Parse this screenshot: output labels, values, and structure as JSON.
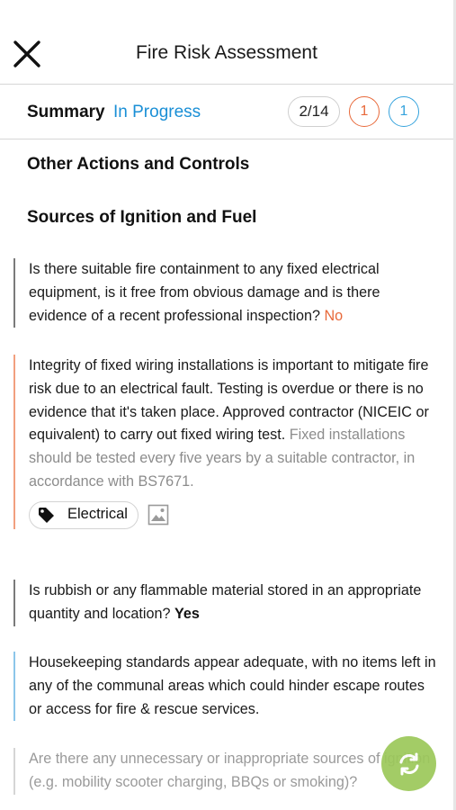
{
  "header": {
    "title": "Fire Risk Assessment",
    "close_icon": "close-icon"
  },
  "summary": {
    "label": "Summary",
    "status": "In Progress",
    "progress": "2/14",
    "badge_orange": "1",
    "badge_blue": "1",
    "colors": {
      "status": "#1a8fd6",
      "orange": "#e8693a",
      "blue": "#35a3dd"
    }
  },
  "sections": [
    {
      "title": "Other Actions and Controls"
    },
    {
      "title": "Sources of Ignition and Fuel"
    }
  ],
  "items": [
    {
      "question": "Is there suitable fire containment to any fixed electrical equipment, is it free from obvious damage and is there evidence of a recent professional inspection?",
      "answer": "No"
    },
    {
      "action": "Integrity of fixed wiring installations is important to mitigate fire risk due to an electrical fault. Testing is overdue or there is no evidence that it's taken place. Approved contractor (NICEIC or equivalent) to carry out fixed wiring test.",
      "guidance": "Fixed installations should be tested every five years by a suitable contractor, in accordance with BS7671.",
      "tag": "Electrical",
      "tag_icon": "tag-icon",
      "attachment_icon": "image-icon"
    },
    {
      "question": "Is rubbish or any flammable material stored in an appropriate quantity and location?",
      "answer": "Yes"
    },
    {
      "note": "Housekeeping standards appear adequate, with no items left in any of the communal areas which could hinder escape routes or access for fire & rescue services."
    },
    {
      "question": "Are there any unnecessary or inappropriate sources of ignition (e.g. mobility scooter charging, BBQs or smoking)?"
    }
  ],
  "fab": {
    "icon": "sync-icon",
    "color": "#9cc85a"
  }
}
